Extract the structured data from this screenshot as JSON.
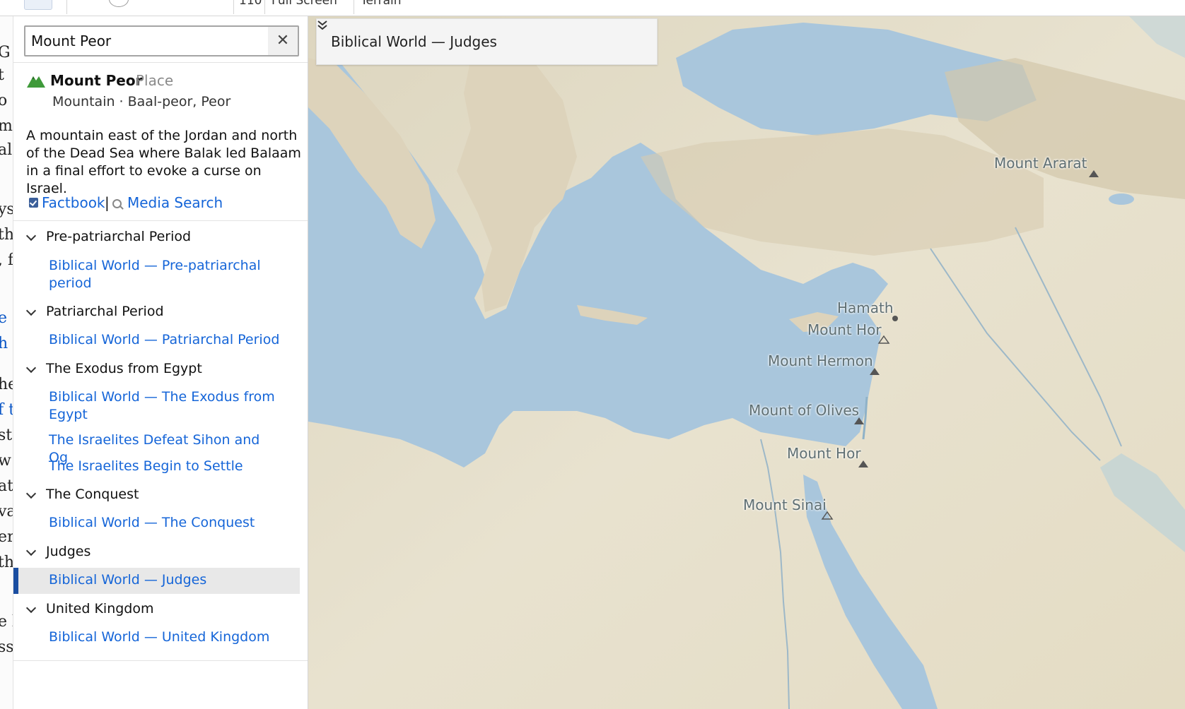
{
  "toolbar": {
    "partial_texts": [
      "110",
      "Full Screen",
      "Terrain"
    ]
  },
  "document_fragments": [
    {
      "text": "G",
      "link": false
    },
    {
      "text": "t",
      "link": false
    },
    {
      "text": "o",
      "link": false
    },
    {
      "text": "m",
      "link": false
    },
    {
      "text": "al",
      "link": false
    },
    {
      "text": "ys",
      "link": false
    },
    {
      "text": "th",
      "link": false
    },
    {
      "text": ", f",
      "link": false
    },
    {
      "text": "e",
      "link": true
    },
    {
      "text": "h w",
      "link": true
    },
    {
      "text": "he",
      "link": false
    },
    {
      "text": "f t",
      "link": true
    },
    {
      "text": "st",
      "link": false
    },
    {
      "text": "w",
      "link": false
    },
    {
      "text": "at",
      "link": false
    },
    {
      "text": "va",
      "link": false
    },
    {
      "text": "er",
      "link": false
    },
    {
      "text": "th",
      "link": false
    },
    {
      "text": "e b",
      "link": false
    },
    {
      "text": "ss",
      "link": false
    }
  ],
  "search": {
    "value": "Mount Peor",
    "clear_label": "✕"
  },
  "place": {
    "name": "Mount Peor",
    "kind": "Place",
    "subtitle": "Mountain · Baal-peor, Peor",
    "description": "A mountain east of the Jordan and north of the Dead Sea where Balak led Balaam in a final effort to evoke a curse on Israel.",
    "link_factbook": "Factbook",
    "link_separator": "|",
    "link_media": "Media Search",
    "icon": "mountain-icon",
    "icon_color": "#3f9a3a"
  },
  "sections": [
    {
      "heading": "Pre-patriarchal Period",
      "items": [
        "Biblical World — Pre-patriarchal period"
      ]
    },
    {
      "heading": "Patriarchal Period",
      "items": [
        "Biblical World — Patriarchal Period"
      ]
    },
    {
      "heading": "The Exodus from Egypt",
      "items": [
        "Biblical World — The Exodus from Egypt",
        "The Israelites Defeat Sihon and Og",
        "The Israelites Begin to Settle"
      ]
    },
    {
      "heading": "The Conquest",
      "items": [
        "Biblical World — The Conquest"
      ]
    },
    {
      "heading": "Judges",
      "items": [
        "Biblical World — Judges"
      ]
    },
    {
      "heading": "United Kingdom",
      "items": [
        "Biblical World — United Kingdom"
      ]
    }
  ],
  "selected_item": "Biblical World — Judges",
  "map": {
    "selector_label": "Biblical World — Judges",
    "labels": [
      {
        "text": "Mount Ararat",
        "marker": "filled-triangle"
      },
      {
        "text": "Hamath",
        "marker": "dot"
      },
      {
        "text": "Mount Hor",
        "marker": "outline-triangle"
      },
      {
        "text": "Mount Hermon",
        "marker": "filled-triangle"
      },
      {
        "text": "Mount of Olives",
        "marker": "filled-triangle"
      },
      {
        "text": "Mount Hor",
        "marker": "filled-triangle"
      },
      {
        "text": "Mount Sinai",
        "marker": "outline-triangle"
      }
    ],
    "colors": {
      "water": "#a9c6dc",
      "land": "#e7e1cd",
      "accent": "#1b4ea1",
      "link": "#1565d8"
    }
  }
}
